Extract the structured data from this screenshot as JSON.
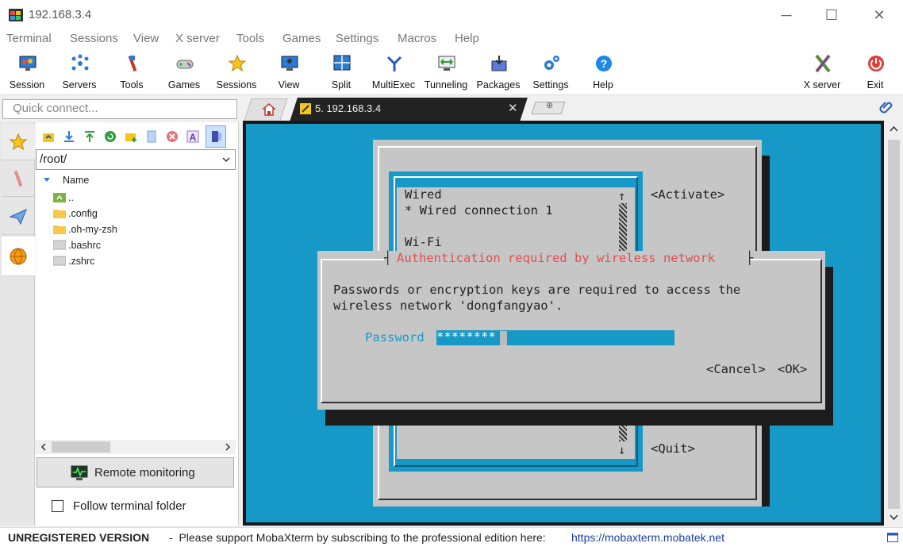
{
  "window": {
    "title": "192.168.3.4",
    "minimize_icon": "─",
    "maximize_icon": "☐",
    "close_icon": "✕"
  },
  "menu": [
    "Terminal",
    "Sessions",
    "View",
    "X server",
    "Tools",
    "Games",
    "Settings",
    "Macros",
    "Help"
  ],
  "toolbar": [
    "Session",
    "Servers",
    "Tools",
    "Games",
    "Sessions",
    "View",
    "Split",
    "MultiExec",
    "Tunneling",
    "Packages",
    "Settings",
    "Help"
  ],
  "toolbar_right": [
    "X server",
    "Exit"
  ],
  "quick_connect": {
    "placeholder": "Quick connect..."
  },
  "tabs": {
    "active_label": "5. 192.168.3.4",
    "close_icon": "✕"
  },
  "sftp": {
    "path": "/root/",
    "column_name": "Name",
    "files": [
      "..",
      ".config",
      ".oh-my-zsh",
      ".bashrc",
      ".zshrc"
    ],
    "remote_monitoring": "Remote monitoring",
    "follow_folder": "Follow terminal folder",
    "follow_checked": false
  },
  "terminal": {
    "list_header": "Wired",
    "list_item": "* Wired connection 1",
    "list_section": "Wi-Fi",
    "activate": "<Activate>",
    "quit": "<Quit>",
    "scroll_up": "↑",
    "scroll_down": "↓",
    "dialog_title": "Authentication required by wireless network",
    "dialog_line1": "Passwords or encryption keys are required to access the",
    "dialog_line2": "wireless network 'dongfangyao'.",
    "password_label": "Password",
    "password_value": "********",
    "cancel": "<Cancel>",
    "ok": "<OK>"
  },
  "status": {
    "unregistered": "UNREGISTERED VERSION",
    "message": "-  Please support MobaXterm by subscribing to the professional edition here:",
    "link": "https://mobaxterm.mobatek.net"
  },
  "colors": {
    "terminal_bg": "#1699c6",
    "dialog_title": "#e05050",
    "password_field": "#1699c6",
    "link": "#1a3fa8"
  }
}
